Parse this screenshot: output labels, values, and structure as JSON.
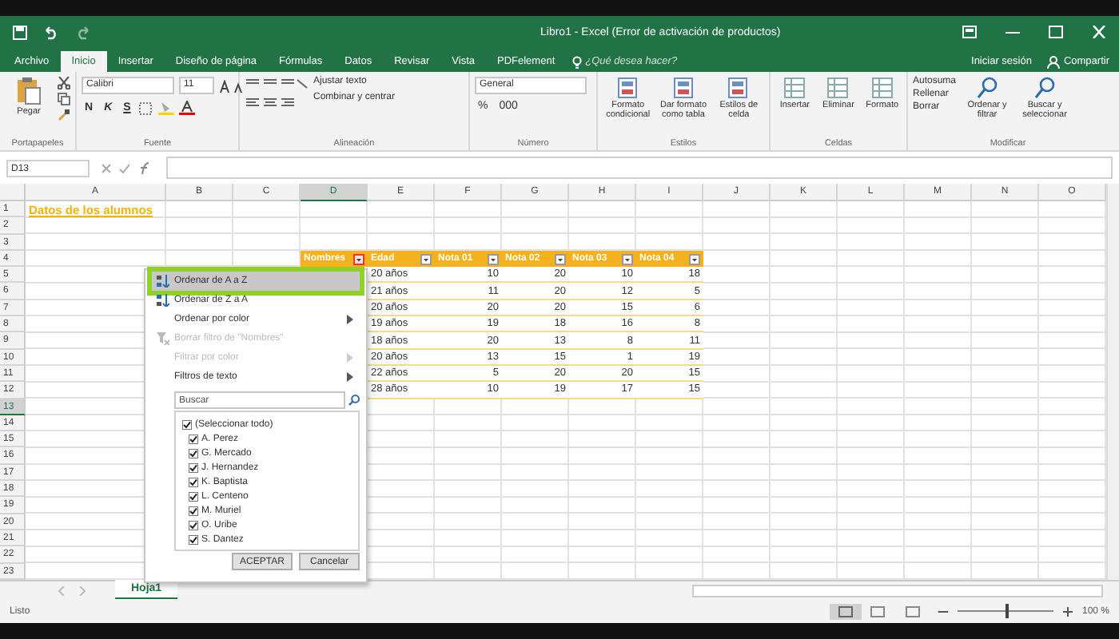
{
  "window": {
    "title": "Libro1 - Excel (Error de activación de productos)"
  },
  "ribbon_tabs": [
    {
      "label": "Archivo",
      "selected": false
    },
    {
      "label": "Inicio",
      "selected": true
    },
    {
      "label": "Insertar",
      "selected": false
    },
    {
      "label": "Diseño de página",
      "selected": false
    },
    {
      "label": "Fórmulas",
      "selected": false
    },
    {
      "label": "Datos",
      "selected": false
    },
    {
      "label": "Revisar",
      "selected": false
    },
    {
      "label": "Vista",
      "selected": false
    },
    {
      "label": "PDFelement",
      "selected": false
    }
  ],
  "tell_me": {
    "placeholder": "¿Qué desea hacer?"
  },
  "account": {
    "sign_in": "Iniciar sesión",
    "share": "Compartir"
  },
  "ribbon": {
    "clipboard": {
      "paste": "Pegar",
      "label": "Portapapeles"
    },
    "font": {
      "name": "Calibri",
      "size": "11",
      "bold": "N",
      "italic": "K",
      "underline": "S",
      "label": "Fuente"
    },
    "alignment": {
      "wrap": "Ajustar texto",
      "merge": "Combinar y centrar",
      "label": "Alineación"
    },
    "number": {
      "format": "General",
      "percent": "%",
      "thousands": "000",
      "label": "Número"
    },
    "styles": {
      "buttons": [
        "Formato condicional",
        "Dar formato como tabla",
        "Estilos de celda"
      ],
      "label": "Estilos"
    },
    "cells": {
      "buttons": [
        "Insertar",
        "Eliminar",
        "Formato"
      ],
      "label": "Celdas"
    },
    "editing": {
      "small": [
        "Autosuma",
        "Rellenar",
        "Borrar"
      ],
      "buttons": [
        "Ordenar y filtrar",
        "Buscar y seleccionar"
      ],
      "label": "Modificar"
    }
  },
  "formula_bar": {
    "name_box": "D13"
  },
  "sheet": {
    "columns": [
      {
        "label": "A",
        "selected": false
      },
      {
        "label": "B",
        "selected": false
      },
      {
        "label": "C",
        "selected": false
      },
      {
        "label": "D",
        "selected": true
      },
      {
        "label": "E",
        "selected": false
      },
      {
        "label": "F",
        "selected": false
      },
      {
        "label": "G",
        "selected": false
      },
      {
        "label": "H",
        "selected": false
      },
      {
        "label": "I",
        "selected": false
      },
      {
        "label": "J",
        "selected": false
      },
      {
        "label": "K",
        "selected": false
      },
      {
        "label": "L",
        "selected": false
      },
      {
        "label": "M",
        "selected": false
      },
      {
        "label": "N",
        "selected": false
      },
      {
        "label": "O",
        "selected": false
      }
    ],
    "rows": [
      {
        "label": "1",
        "selected": false
      },
      {
        "label": "2",
        "selected": false
      },
      {
        "label": "3",
        "selected": false
      },
      {
        "label": "4",
        "selected": false
      },
      {
        "label": "5",
        "selected": false
      },
      {
        "label": "6",
        "selected": false
      },
      {
        "label": "7",
        "selected": false
      },
      {
        "label": "8",
        "selected": false
      },
      {
        "label": "9",
        "selected": false
      },
      {
        "label": "10",
        "selected": false
      },
      {
        "label": "11",
        "selected": false
      },
      {
        "label": "12",
        "selected": false
      },
      {
        "label": "13",
        "selected": true
      },
      {
        "label": "14",
        "selected": false
      },
      {
        "label": "15",
        "selected": false
      },
      {
        "label": "16",
        "selected": false
      },
      {
        "label": "17",
        "selected": false
      },
      {
        "label": "18",
        "selected": false
      },
      {
        "label": "19",
        "selected": false
      },
      {
        "label": "20",
        "selected": false
      },
      {
        "label": "21",
        "selected": false
      },
      {
        "label": "22",
        "selected": false
      },
      {
        "label": "23",
        "selected": false
      }
    ],
    "title": "Datos de los alumnos",
    "table": {
      "headers": [
        {
          "label": "Nombres",
          "open": true
        },
        {
          "label": "Edad",
          "open": false
        },
        {
          "label": "Nota 01",
          "open": false
        },
        {
          "label": "Nota 02",
          "open": false
        },
        {
          "label": "Nota 03",
          "open": false
        },
        {
          "label": "Nota 04",
          "open": false
        }
      ],
      "rows": [
        [
          "20 años",
          "10",
          "20",
          "10",
          "18"
        ],
        [
          "21 años",
          "11",
          "20",
          "12",
          "5"
        ],
        [
          "20 años",
          "20",
          "20",
          "15",
          "6"
        ],
        [
          "19 años",
          "19",
          "18",
          "16",
          "8"
        ],
        [
          "18 años",
          "20",
          "13",
          "8",
          "11"
        ],
        [
          "20 años",
          "13",
          "15",
          "1",
          "19"
        ],
        [
          "22 años",
          "5",
          "20",
          "20",
          "15"
        ],
        [
          "28 años",
          "10",
          "19",
          "17",
          "15"
        ]
      ]
    }
  },
  "filter_menu": {
    "items": [
      {
        "label": "Ordenar de A a Z",
        "kind": "sort-asc",
        "selected": true,
        "disabled": false,
        "submenu": false
      },
      {
        "label": "Ordenar de Z a A",
        "kind": "sort-desc",
        "selected": false,
        "disabled": false,
        "submenu": false
      },
      {
        "label": "Ordenar por color",
        "kind": "plain",
        "selected": false,
        "disabled": false,
        "submenu": true
      },
      {
        "label": "Borrar filtro de \"Nombres\"",
        "kind": "clear-filter",
        "selected": false,
        "disabled": true,
        "submenu": false
      },
      {
        "label": "Filtrar por color",
        "kind": "plain",
        "selected": false,
        "disabled": true,
        "submenu": true
      },
      {
        "label": "Filtros de texto",
        "kind": "plain",
        "selected": false,
        "disabled": false,
        "submenu": true
      }
    ],
    "search": {
      "placeholder": "Buscar"
    },
    "values": [
      {
        "label": "(Seleccionar todo)",
        "checked": true
      },
      {
        "label": "A. Perez",
        "checked": true
      },
      {
        "label": "G. Mercado",
        "checked": true
      },
      {
        "label": "J. Hernandez",
        "checked": true
      },
      {
        "label": "K. Baptista",
        "checked": true
      },
      {
        "label": "L. Centeno",
        "checked": true
      },
      {
        "label": "M. Muriel",
        "checked": true
      },
      {
        "label": "O. Uribe",
        "checked": true
      },
      {
        "label": "S. Dantez",
        "checked": true
      }
    ],
    "buttons": [
      "ACEPTAR",
      "Cancelar"
    ]
  },
  "sheet_tabs": [
    {
      "label": "Hoja1",
      "selected": true
    }
  ],
  "status_bar": {
    "status": "Listo",
    "zoom": "100 %",
    "level": 0.5
  }
}
